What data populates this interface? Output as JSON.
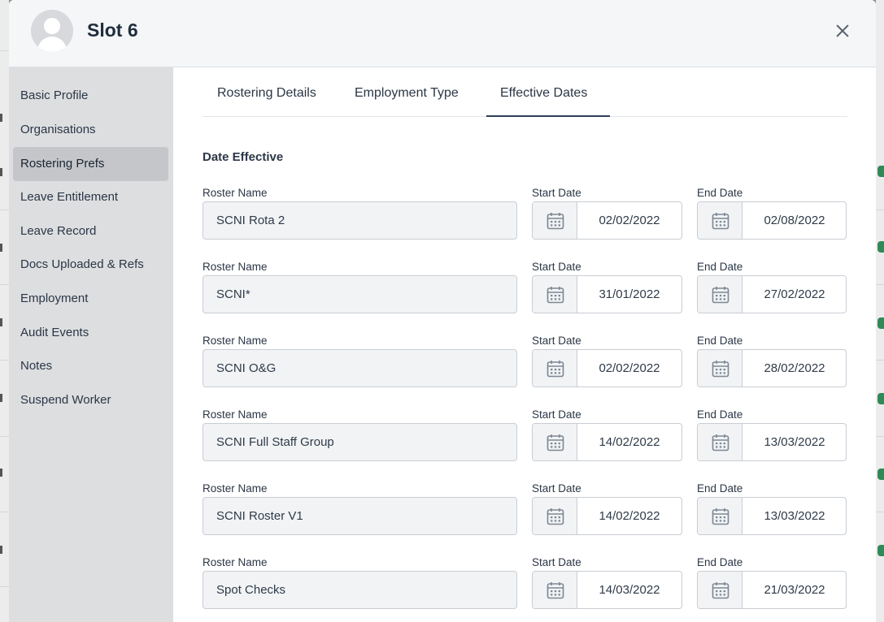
{
  "modal": {
    "title": "Slot 6"
  },
  "sidebar": {
    "items": [
      {
        "label": "Basic Profile",
        "name": "basic-profile"
      },
      {
        "label": "Organisations",
        "name": "organisations"
      },
      {
        "label": "Rostering Prefs",
        "name": "rostering-prefs",
        "active": true
      },
      {
        "label": "Leave Entitlement",
        "name": "leave-entitlement"
      },
      {
        "label": "Leave Record",
        "name": "leave-record"
      },
      {
        "label": "Docs Uploaded & Refs",
        "name": "docs-uploaded-refs"
      },
      {
        "label": "Employment",
        "name": "employment"
      },
      {
        "label": "Audit Events",
        "name": "audit-events"
      },
      {
        "label": "Notes",
        "name": "notes"
      },
      {
        "label": "Suspend Worker",
        "name": "suspend-worker"
      }
    ]
  },
  "tabs": [
    {
      "label": "Rostering Details"
    },
    {
      "label": "Employment Type"
    },
    {
      "label": "Effective Dates",
      "active": true
    }
  ],
  "section": {
    "title": "Date Effective"
  },
  "labels": {
    "roster_name": "Roster Name",
    "start_date": "Start Date",
    "end_date": "End Date"
  },
  "rows": [
    {
      "roster": "SCNI Rota 2",
      "start": "02/02/2022",
      "end": "02/08/2022"
    },
    {
      "roster": "SCNI*",
      "start": "31/01/2022",
      "end": "27/02/2022"
    },
    {
      "roster": "SCNI O&G",
      "start": "02/02/2022",
      "end": "28/02/2022"
    },
    {
      "roster": "SCNI Full Staff Group",
      "start": "14/02/2022",
      "end": "13/03/2022"
    },
    {
      "roster": "SCNI Roster V1",
      "start": "14/02/2022",
      "end": "13/03/2022"
    },
    {
      "roster": "Spot Checks",
      "start": "14/03/2022",
      "end": "21/03/2022"
    }
  ],
  "icons": {
    "calendar": "calendar-icon",
    "close": "close-icon",
    "avatar": "user-avatar-icon"
  },
  "colors": {
    "active_tab_underline": "#2c3e55",
    "sidebar_bg": "#dcdee0",
    "sidebar_active_bg": "#c4c6c9",
    "input_bg": "#f1f3f5"
  }
}
